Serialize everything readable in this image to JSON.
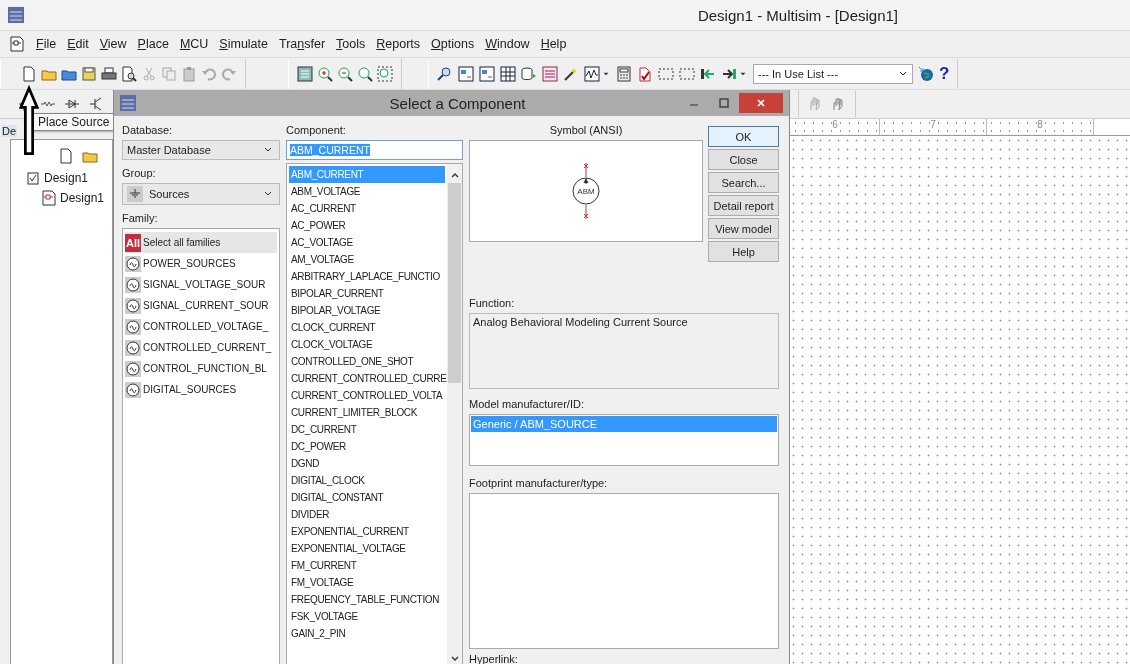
{
  "window": {
    "title": "Design1 - Multisim - [Design1]"
  },
  "menu": [
    {
      "key": "F",
      "post": "ile"
    },
    {
      "key": "E",
      "post": "dit"
    },
    {
      "key": "V",
      "post": "iew"
    },
    {
      "key": "P",
      "post": "lace"
    },
    {
      "key": "M",
      "post": "CU"
    },
    {
      "key": "S",
      "post": "imulate"
    },
    {
      "pre": "Tra",
      "key": "n",
      "post": "sfer"
    },
    {
      "key": "T",
      "post": "ools"
    },
    {
      "key": "R",
      "post": "eports"
    },
    {
      "key": "O",
      "post": "ptions"
    },
    {
      "key": "W",
      "post": "indow"
    },
    {
      "key": "H",
      "post": "elp"
    }
  ],
  "toolbar": {
    "in_use_list": "--- In Use List ---",
    "help_glyph": "?"
  },
  "tooltip": "Place Source",
  "design_toolbox": {
    "tab": "De",
    "tree": [
      {
        "label": "Design1",
        "children": [
          {
            "label": "Design1"
          }
        ]
      }
    ]
  },
  "canvas": {
    "ruler": [
      "6",
      "7",
      "8"
    ]
  },
  "dialog": {
    "title": "Select a Component",
    "database": {
      "label": "Database:",
      "value": "Master Database"
    },
    "group": {
      "label": "Group:",
      "value": "Sources"
    },
    "family": {
      "label": "Family:",
      "items": [
        {
          "label": "Select all families",
          "badge": "All",
          "selected": true
        },
        {
          "label": "POWER_SOURCES",
          "selected": false
        },
        {
          "label": "SIGNAL_VOLTAGE_SOUR",
          "selected": false
        },
        {
          "label": "SIGNAL_CURRENT_SOUR",
          "selected": false
        },
        {
          "label": "CONTROLLED_VOLTAGE_",
          "selected": false
        },
        {
          "label": "CONTROLLED_CURRENT_",
          "selected": false
        },
        {
          "label": "CONTROL_FUNCTION_BL",
          "selected": false
        },
        {
          "label": "DIGITAL_SOURCES",
          "selected": false
        }
      ]
    },
    "component": {
      "label": "Component:",
      "value": "ABM_CURRENT",
      "value_selected": true,
      "items": [
        {
          "label": "ABM_CURRENT",
          "selected": true
        },
        {
          "label": "ABM_VOLTAGE",
          "selected": false
        },
        {
          "label": "AC_CURRENT",
          "selected": false
        },
        {
          "label": "AC_POWER",
          "selected": false
        },
        {
          "label": "AC_VOLTAGE",
          "selected": false
        },
        {
          "label": "AM_VOLTAGE",
          "selected": false
        },
        {
          "label": "ARBITRARY_LAPLACE_FUNCTIO",
          "selected": false
        },
        {
          "label": "BIPOLAR_CURRENT",
          "selected": false
        },
        {
          "label": "BIPOLAR_VOLTAGE",
          "selected": false
        },
        {
          "label": "CLOCK_CURRENT",
          "selected": false
        },
        {
          "label": "CLOCK_VOLTAGE",
          "selected": false
        },
        {
          "label": "CONTROLLED_ONE_SHOT",
          "selected": false
        },
        {
          "label": "CURRENT_CONTROLLED_CURRE",
          "selected": false
        },
        {
          "label": "CURRENT_CONTROLLED_VOLTA",
          "selected": false
        },
        {
          "label": "CURRENT_LIMITER_BLOCK",
          "selected": false
        },
        {
          "label": "DC_CURRENT",
          "selected": false
        },
        {
          "label": "DC_POWER",
          "selected": false
        },
        {
          "label": "DGND",
          "selected": false
        },
        {
          "label": "DIGITAL_CLOCK",
          "selected": false
        },
        {
          "label": "DIGITAL_CONSTANT",
          "selected": false
        },
        {
          "label": "DIVIDER",
          "selected": false
        },
        {
          "label": "EXPONENTIAL_CURRENT",
          "selected": false
        },
        {
          "label": "EXPONENTIAL_VOLTAGE",
          "selected": false
        },
        {
          "label": "FM_CURRENT",
          "selected": false
        },
        {
          "label": "FM_VOLTAGE",
          "selected": false
        },
        {
          "label": "FREQUENCY_TABLE_FUNCTION",
          "selected": false
        },
        {
          "label": "FSK_VOLTAGE",
          "selected": false
        },
        {
          "label": "GAIN_2_PIN",
          "selected": false
        }
      ]
    },
    "symbol": {
      "label": "Symbol (ANSI)",
      "mark": "ABM"
    },
    "buttons": [
      {
        "label": "OK",
        "default": true
      },
      {
        "label": "Close",
        "default": false
      },
      {
        "label": "Search...",
        "default": false
      },
      {
        "label": "Detail report",
        "default": false
      },
      {
        "label": "View model",
        "default": false
      },
      {
        "label": "Help",
        "default": false
      }
    ],
    "function": {
      "label": "Function:",
      "text": "Analog Behavioral Modeling Current Source"
    },
    "model": {
      "label": "Model manufacturer/ID:",
      "items": [
        {
          "label": "Generic / ABM_SOURCE",
          "selected": true
        }
      ]
    },
    "footprint": {
      "label": "Footprint manufacturer/type:"
    },
    "hyperlink": {
      "label": "Hyperlink:"
    }
  }
}
